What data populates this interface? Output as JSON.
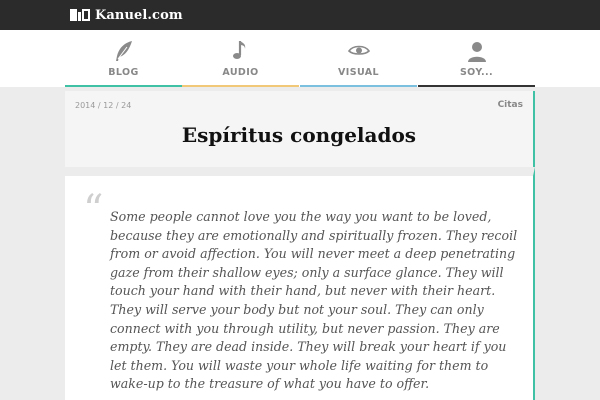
{
  "site": {
    "name": "Kanuel.com"
  },
  "nav": {
    "items": [
      {
        "label": "BLOG",
        "icon": "quill-icon",
        "accent": "#3ec1a4"
      },
      {
        "label": "AUDIO",
        "icon": "music-note-icon",
        "accent": "#f0c878"
      },
      {
        "label": "VISUAL",
        "icon": "eye-icon",
        "accent": "#7cc0e0"
      },
      {
        "label": "SOY...",
        "icon": "user-icon",
        "accent": "#333333"
      }
    ]
  },
  "post": {
    "date": "2014 / 12 / 24",
    "category": "Citas",
    "title": "Espíritus congelados",
    "quote": "Some people cannot love you the way you want to be loved, because they are emotionally and spiritually frozen. They recoil from or avoid affection. You will never meet a deep penetrating gaze from their shallow eyes; only a surface glance. They will touch your hand with their hand, but never with their heart. They will serve your body but not your soul. They can only connect with you through utility, but never passion. They are empty. They are dead inside. They will break your heart if you let them. You will waste your whole life waiting for them to wake-up to the treasure of what you have to offer."
  },
  "colors": {
    "accent": "#3ec1a4",
    "topbar": "#2b2b2b"
  }
}
